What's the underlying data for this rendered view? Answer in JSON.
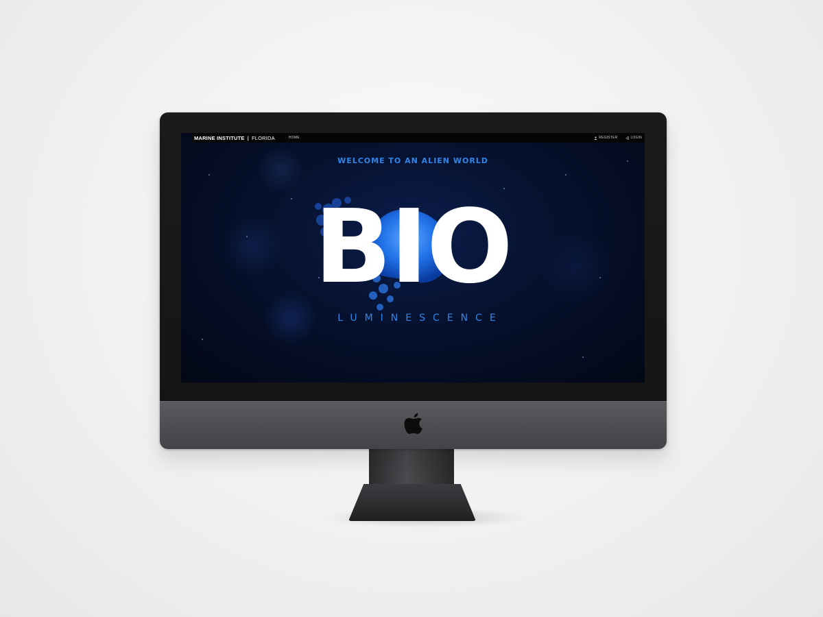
{
  "navbar": {
    "brand": "MARINE INSTITUTE",
    "separator": "|",
    "brand_sub": "FLORIDA",
    "home_label": "HOME",
    "register_label": "REGISTER",
    "login_label": "LOGIN"
  },
  "hero": {
    "tagline": "WELCOME TO AN ALIEN WORLD",
    "title": "BIO",
    "subtitle": "LUMINESCENCE"
  },
  "colors": {
    "accent": "#2f86e8",
    "screen_bg": "#06112e",
    "navbar_bg": "#050505",
    "title": "#ffffff"
  },
  "icons": [
    "user-icon",
    "login-icon",
    "apple-logo-icon",
    "jellyfish-illustration"
  ]
}
